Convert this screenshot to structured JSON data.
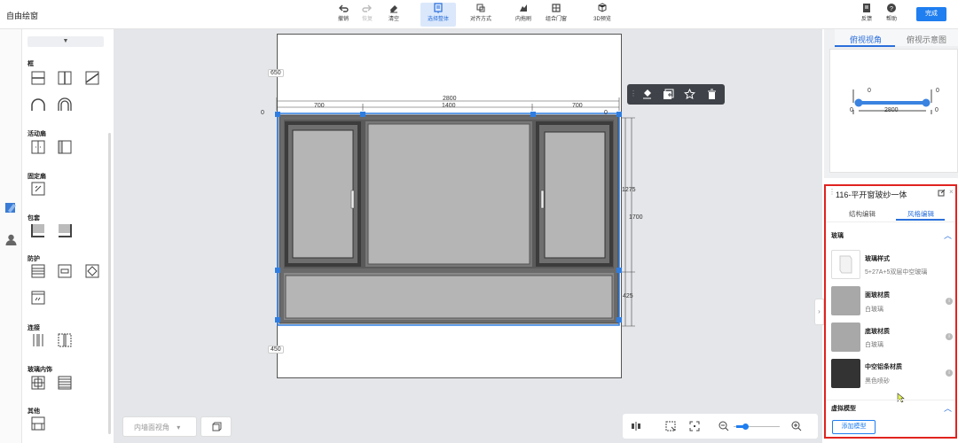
{
  "app": {
    "title": "自由绘窗"
  },
  "toolbar": {
    "undo": "撤销",
    "redo": "恢复",
    "clear": "清空",
    "select_all": "选择整体",
    "align": "对齐方式",
    "inner_frame": "内拖刷",
    "combine_door": "组合门窗",
    "preview_3d": "3D预览",
    "feedback": "反馈",
    "help": "帮助",
    "done": "完成"
  },
  "palette": {
    "select_caret": "▼",
    "sections": {
      "frame": "框",
      "sash": "活动扇",
      "fixed_sash": "固定扇",
      "wrap": "包套",
      "protect": "防护",
      "connect": "连接",
      "glass_deco": "玻璃内饰",
      "other": "其他"
    }
  },
  "canvas": {
    "dims": {
      "top_height": "650",
      "bottom_height": "450",
      "total_width": "2800",
      "left_width": "700",
      "mid_width": "1400",
      "right_width": "700",
      "origin_left": "0",
      "origin_right": "0",
      "total_height": "1700",
      "upper_height": "1275",
      "lower_height": "425"
    },
    "view_select": "内墙面视角",
    "view_select_caret": "▾"
  },
  "right": {
    "view_tabs": {
      "top_view": "俯视视角",
      "top_diagram": "俯视示意图"
    },
    "mini": {
      "width": "2800",
      "l_top": "0",
      "r_top": "0",
      "l_out": "0",
      "r_out": "0"
    },
    "prop_title": "116-平开窗玻纱一体",
    "sub_tabs": {
      "structure": "结构编辑",
      "style": "风格编辑"
    },
    "glass_section": "玻璃",
    "items": [
      {
        "name": "玻璃样式",
        "value": "5+27A+5双层中空玻璃"
      },
      {
        "name": "面玻材质",
        "value": "白玻璃"
      },
      {
        "name": "底玻材质",
        "value": "白玻璃"
      },
      {
        "name": "中空铝条材质",
        "value": "黑色喷砂"
      }
    ],
    "virtual_section": "虚拟模型",
    "add_model": "添加模型"
  },
  "colors": {
    "accent": "#1f7ef0",
    "highlight": "#e0231f",
    "frame": "#5a5a5a",
    "glass": "#b3b3b3"
  }
}
